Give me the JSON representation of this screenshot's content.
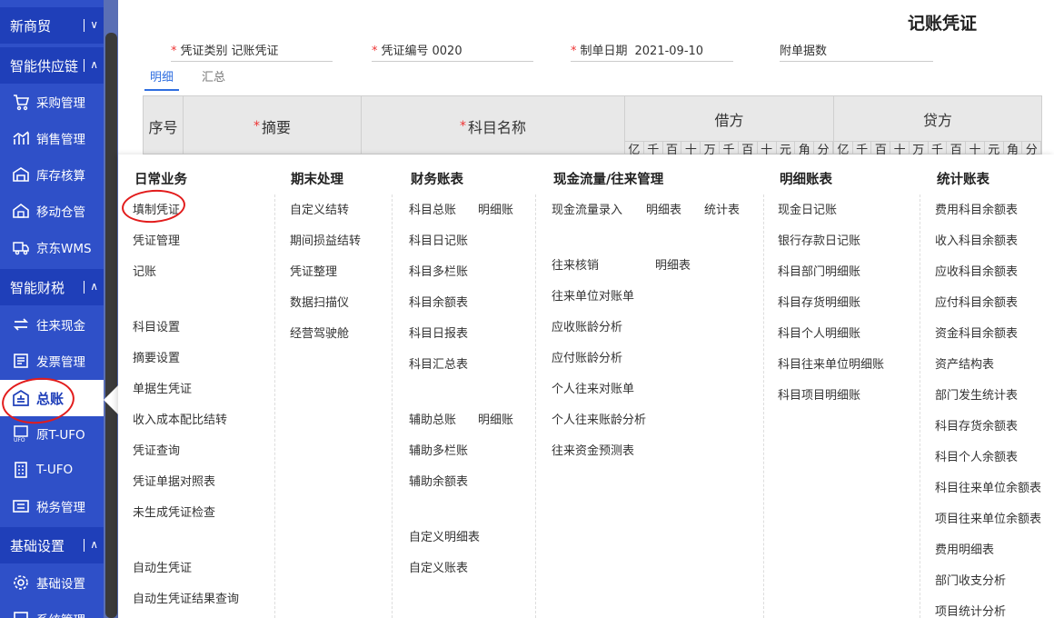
{
  "sidebar": {
    "sections": {
      "xinshangmao": "新商贸",
      "supply": "智能供应链",
      "finance": "智能财税",
      "basic": "基础设置"
    },
    "toggles": {
      "collapsed": "∨",
      "expanded": "∧"
    },
    "items": {
      "purchase": "采购管理",
      "sales": "销售管理",
      "inventory": "库存核算",
      "mobile": "移动仓管",
      "jdwms": "京东WMS",
      "cash": "往来现金",
      "invoice": "发票管理",
      "ledger": "总账",
      "tufo_old": "原T-UFO",
      "tufo": "T-UFO",
      "tax": "税务管理",
      "basic_settings": "基础设置",
      "system": "系统管理"
    }
  },
  "voucher": {
    "title": "记账凭证",
    "type_label": "凭证类别",
    "type_value": "记账凭证",
    "number_label": "凭证编号",
    "number_value": "0020",
    "date_label": "制单日期",
    "date_value": "2021-09-10",
    "attachments_label": "附单据数",
    "tabs": {
      "detail": "明细",
      "summary": "汇总"
    },
    "table": {
      "seq": "序号",
      "summary": "摘要",
      "account": "科目名称",
      "debit": "借方",
      "credit": "贷方",
      "digits": [
        "亿",
        "千",
        "百",
        "十",
        "万",
        "千",
        "百",
        "十",
        "元",
        "角",
        "分"
      ]
    }
  },
  "menu": {
    "daily": {
      "title": "日常业务",
      "items": [
        "填制凭证",
        "凭证管理",
        "记账",
        "科目设置",
        "摘要设置",
        "单据生凭证",
        "收入成本配比结转",
        "凭证查询",
        "凭证单据对照表",
        "未生成凭证检查",
        "自动生凭证",
        "自动生凭证结果查询"
      ]
    },
    "period": {
      "title": "期末处理",
      "items": [
        "自定义结转",
        "期间损益结转",
        "凭证整理",
        "数据扫描仪",
        "经营驾驶舱"
      ]
    },
    "books": {
      "title": "财务账表",
      "items": [
        "科目总账",
        "明细账",
        "科目日记账",
        "科目多栏账",
        "科目余额表",
        "科目日报表",
        "科目汇总表",
        "辅助总账",
        "明细账",
        "辅助多栏账",
        "辅助余额表",
        "自定义明细表",
        "自定义账表"
      ]
    },
    "cashflow": {
      "title": "现金流量/往来管理",
      "items": [
        "现金流量录入",
        "明细表",
        "统计表",
        "往来核销",
        "明细表",
        "往来单位对账单",
        "应收账龄分析",
        "应付账龄分析",
        "个人往来对账单",
        "个人往来账龄分析",
        "往来资金预测表"
      ]
    },
    "detail": {
      "title": "明细账表",
      "items": [
        "现金日记账",
        "银行存款日记账",
        "科目部门明细账",
        "科目存货明细账",
        "科目个人明细账",
        "科目往来单位明细账",
        "科目项目明细账"
      ]
    },
    "stats": {
      "title": "统计账表",
      "items": [
        "费用科目余额表",
        "收入科目余额表",
        "应收科目余额表",
        "应付科目余额表",
        "资金科目余额表",
        "资产结构表",
        "部门发生统计表",
        "科目存货余额表",
        "科目个人余额表",
        "科目往来单位余额表",
        "项目往来单位余额表",
        "费用明细表",
        "部门收支分析",
        "项目统计分析"
      ]
    }
  }
}
